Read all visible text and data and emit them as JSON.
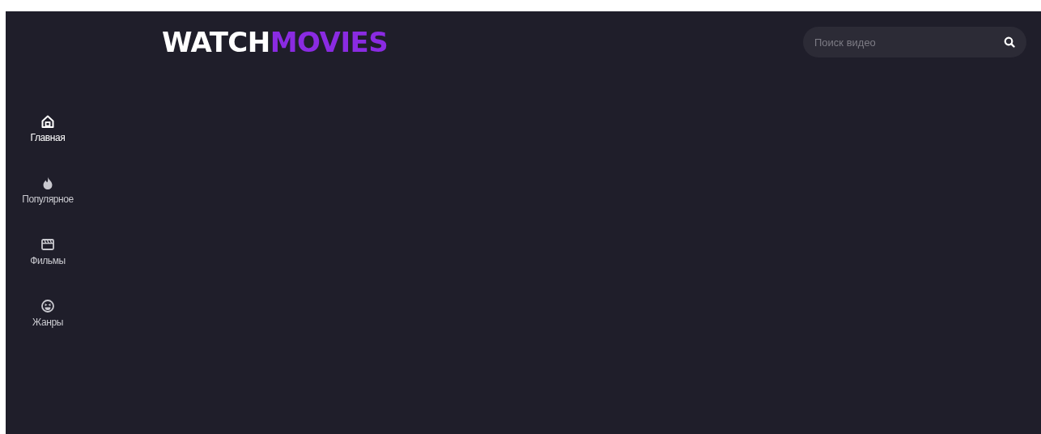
{
  "logo": {
    "first": "WATCH",
    "second": "MOVIES"
  },
  "search": {
    "placeholder": "Поиск видео"
  },
  "sidebar": {
    "items": [
      {
        "kind": "home",
        "label": "Главная",
        "selected": true
      },
      {
        "kind": "fire",
        "label": "Популярное",
        "selected": false
      },
      {
        "kind": "clapper",
        "label": "Фильмы",
        "selected": false
      },
      {
        "kind": "smile",
        "label": "Жанры",
        "selected": false
      }
    ]
  }
}
